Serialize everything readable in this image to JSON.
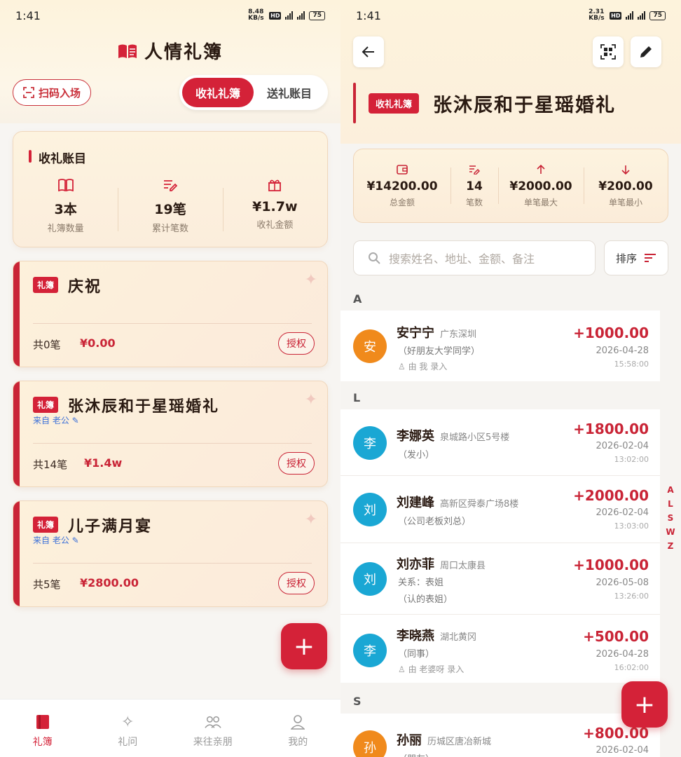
{
  "left": {
    "status": {
      "time": "1:41",
      "net": "8.48 KB/s",
      "battery": "75"
    },
    "title": "人情礼簿",
    "scan_label": "扫码入场",
    "seg": {
      "received": "收礼礼簿",
      "sent": "送礼账目"
    },
    "summary": {
      "title": "收礼账目",
      "stats": [
        {
          "icon": "book-icon",
          "value": "3本",
          "label": "礼簿数量"
        },
        {
          "icon": "note-edit-icon",
          "value": "19笔",
          "label": "累计笔数"
        },
        {
          "icon": "gift-icon",
          "value": "¥1.7w",
          "label": "收礼金额"
        }
      ]
    },
    "books": [
      {
        "tag": "礼簿",
        "name": "庆祝",
        "from": "",
        "count": "共0笔",
        "amount": "¥0.00",
        "auth": "授权"
      },
      {
        "tag": "礼簿",
        "name": "张沐辰和于星瑶婚礼",
        "from": "来自 老公 ✎",
        "count": "共14笔",
        "amount": "¥1.4w",
        "auth": "授权"
      },
      {
        "tag": "礼簿",
        "name": "儿子满月宴",
        "from": "来自 老公 ✎",
        "count": "共5笔",
        "amount": "¥2800.00",
        "auth": "授权"
      }
    ],
    "tabs": [
      {
        "label": "礼簿",
        "icon": "book-icon"
      },
      {
        "label": "礼问",
        "icon": "sparkle-icon"
      },
      {
        "label": "来往亲朋",
        "icon": "people-icon"
      },
      {
        "label": "我的",
        "icon": "person-icon"
      }
    ]
  },
  "right": {
    "status": {
      "time": "1:41",
      "net": "2.31 KB/s",
      "battery": "75"
    },
    "tag": "收礼礼簿",
    "title": "张沐辰和于星瑶婚礼",
    "stats": [
      {
        "icon": "wallet-icon",
        "value": "¥14200.00",
        "label": "总金额"
      },
      {
        "icon": "note-edit-icon",
        "value": "14",
        "label": "笔数"
      },
      {
        "icon": "arrow-up-icon",
        "value": "¥2000.00",
        "label": "单笔最大"
      },
      {
        "icon": "arrow-down-icon",
        "value": "¥200.00",
        "label": "单笔最小"
      }
    ],
    "search_placeholder": "搜索姓名、地址、金额、备注",
    "sort_label": "排序",
    "groups": [
      "A",
      "L",
      "S"
    ],
    "entries": [
      {
        "avatar": "安",
        "name": "安宁宁",
        "addr": "广东深圳",
        "sub": "（好朋友大学同学）",
        "sub2": "由 我 录入",
        "amount": "+1000.00",
        "date": "2026-04-28",
        "time": "15:58:00",
        "color": "#f08a1c"
      },
      {
        "avatar": "李",
        "name": "李娜英",
        "addr": "泉城路小区5号楼",
        "sub": "（发小）",
        "sub2": "",
        "amount": "+1800.00",
        "date": "2026-02-04",
        "time": "13:02:00",
        "color": "#1aa7d4"
      },
      {
        "avatar": "刘",
        "name": "刘建峰",
        "addr": "高新区舜泰广场8楼",
        "sub": "（公司老板刘总）",
        "sub2": "",
        "amount": "+2000.00",
        "date": "2026-02-04",
        "time": "13:03:00",
        "color": "#1aa7d4"
      },
      {
        "avatar": "刘",
        "name": "刘亦菲",
        "addr": "周口太康县",
        "sub": "关系：表姐",
        "sub2": "（认的表姐）",
        "amount": "+1000.00",
        "date": "2026-05-08",
        "time": "13:26:00",
        "color": "#1aa7d4"
      },
      {
        "avatar": "李",
        "name": "李晓燕",
        "addr": "湖北黄冈",
        "sub": "（同事）",
        "sub2": "由 老婆呀 录入",
        "amount": "+500.00",
        "date": "2026-04-28",
        "time": "16:02:00",
        "color": "#1aa7d4"
      },
      {
        "avatar": "孙",
        "name": "孙丽",
        "addr": "历城区唐冶新城",
        "sub": "（朋友）",
        "sub2": "",
        "amount": "+800.00",
        "date": "2026-02-04",
        "time": "",
        "color": "#f08a1c"
      }
    ],
    "index": [
      "A",
      "L",
      "S",
      "W",
      "Z"
    ]
  },
  "colors": {
    "accent": "#d42238",
    "blue_avatar": "#1aa7d4",
    "orange_avatar": "#f08a1c"
  }
}
